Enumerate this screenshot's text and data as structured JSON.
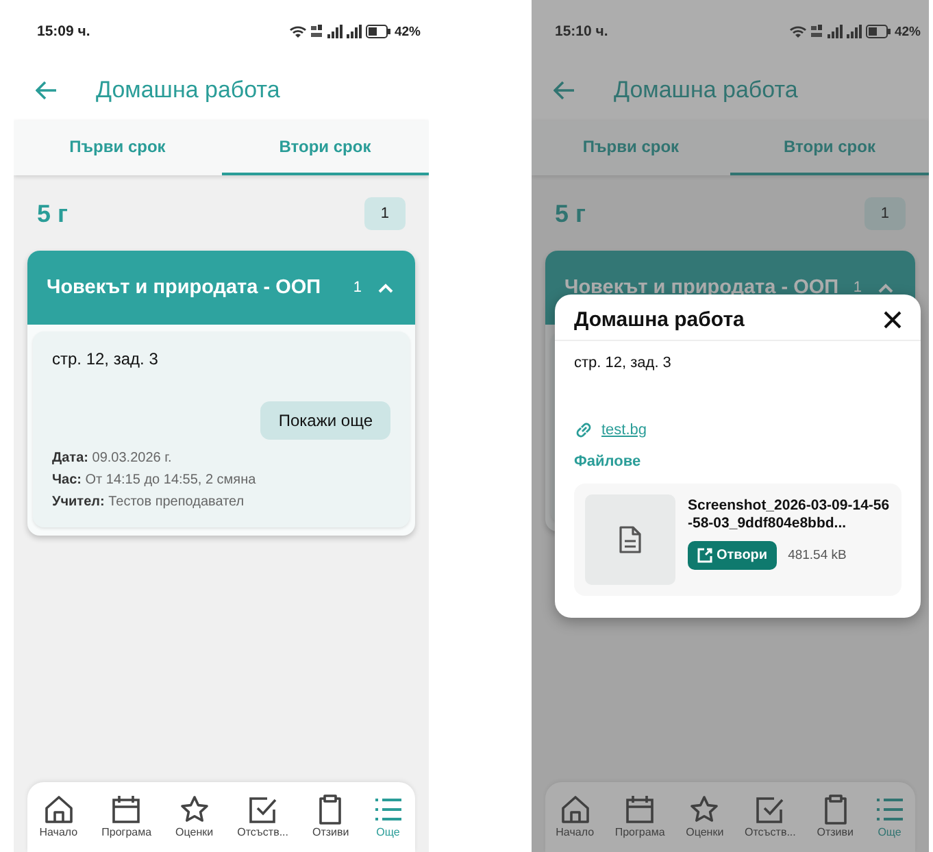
{
  "screens": [
    {
      "status_bar": {
        "time": "15:09 ч.",
        "battery": "42%"
      },
      "title": "Домашна работа",
      "tabs": [
        {
          "label": "Първи срок",
          "selected": false
        },
        {
          "label": "Втори срок",
          "selected": true
        }
      ],
      "class_label": "5 г",
      "class_count": "1",
      "subject": {
        "name": "Човекът и природата - ООП",
        "count": "1",
        "expanded": true
      },
      "homework": {
        "text": "стр. 12, зад. 3",
        "button": "Покажи още",
        "details": [
          "**Дата:** 09.03.2026 г.",
          "**Час:** От 14:15 до 14:55, 2 смяна",
          "**Учител:** Тестов преподавател"
        ]
      },
      "nav": [
        {
          "label": "Начало",
          "selected": false
        },
        {
          "label": "Програма",
          "selected": false
        },
        {
          "label": "Оценки",
          "selected": false
        },
        {
          "label": "Отсъств...",
          "selected": false
        },
        {
          "label": "Отзиви",
          "selected": false
        },
        {
          "label": "Още",
          "selected": true
        }
      ]
    },
    {
      "status_bar": {
        "time": "15:10 ч.",
        "battery": "42%"
      },
      "title": "Домашна работа",
      "tabs": [
        {
          "label": "Първи срок",
          "selected": false
        },
        {
          "label": "Втори срок",
          "selected": true
        }
      ],
      "class_label": "5 г",
      "class_count": "1",
      "subject": {
        "name": "Човекът и природата - ООП",
        "count": "1",
        "expanded": true
      },
      "nav": [
        {
          "label": "Начало",
          "selected": false
        },
        {
          "label": "Програма",
          "selected": false
        },
        {
          "label": "Оценки",
          "selected": false
        },
        {
          "label": "Отсъств...",
          "selected": false
        },
        {
          "label": "Отзиви",
          "selected": false
        },
        {
          "label": "Още",
          "selected": true
        }
      ],
      "dialog": {
        "title": "Домашна работа",
        "text": "стр. 12, зад. 3",
        "link": "test.bg",
        "files_heading": "Файлове",
        "files": [
          {
            "name": "Screenshot_2026-03-09-14-56-58-03_9ddf804e8bbd...",
            "open_button": "Отвори",
            "size": "481.54 kB"
          }
        ]
      }
    }
  ]
}
